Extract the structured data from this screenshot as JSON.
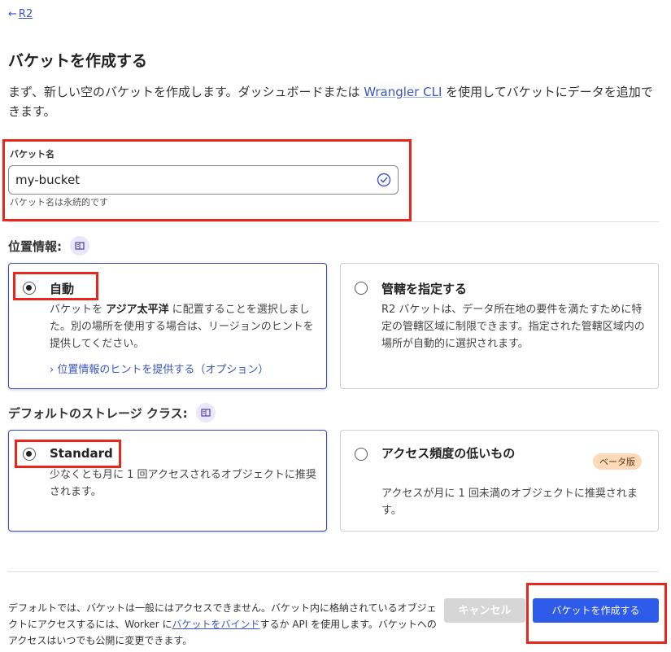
{
  "nav": {
    "back_arrow": "←",
    "back_label": "R2"
  },
  "page": {
    "title": "バケットを作成する",
    "intro_before": "まず、新しい空のバケットを作成します。ダッシュボードまたは ",
    "intro_link": "Wrangler CLI",
    "intro_after": " を使用してバケットにデータを追加できます。"
  },
  "bucket_name": {
    "label": "バケット名",
    "value": "my-bucket",
    "hint": "バケット名は永続的です",
    "status_icon": "check-circle-icon"
  },
  "location": {
    "label": "位置情報:",
    "help_icon": "book-icon",
    "options": [
      {
        "title": "自動",
        "desc_before": "バケットを ",
        "desc_bold": "アジア太平洋",
        "desc_after": " に配置することを選択しました。別の場所を使用する場合は、リージョンのヒントを提供してください。",
        "link": "› 位置情報のヒントを提供する（オプション）",
        "selected": true
      },
      {
        "title": "管轄を指定する",
        "desc": "R2 バケットは、データ所在地の要件を満たすために特定の管轄区域に制限できます。指定された管轄区域内の場所が自動的に選択されます。",
        "selected": false
      }
    ]
  },
  "storage_class": {
    "label": "デフォルトのストレージ クラス:",
    "help_icon": "book-icon",
    "options": [
      {
        "title": "Standard",
        "desc": "少なくとも月に 1 回アクセスされるオブジェクトに推奨されます。",
        "selected": true
      },
      {
        "title": "アクセス頻度の低いもの",
        "badge": "ベータ版",
        "desc": "アクセスが月に 1 回未満のオブジェクトに推奨されます。",
        "selected": false
      }
    ]
  },
  "footer": {
    "note_before": "デフォルトでは、バケットは一般にはアクセスできません。バケット内に格納されているオブジェクトにアクセスするには、Worker に",
    "note_link": "バケットをバインド",
    "note_after": "するか API を使用します。バケットへのアクセスはいつでも公開に変更できます。",
    "cancel_label": "キャンセル",
    "create_label": "バケットを作成する"
  },
  "colors": {
    "accent": "#2f5bea",
    "link": "#3b55c7",
    "highlight_border": "#e8261b",
    "badge_bg": "#fbd9b9"
  }
}
